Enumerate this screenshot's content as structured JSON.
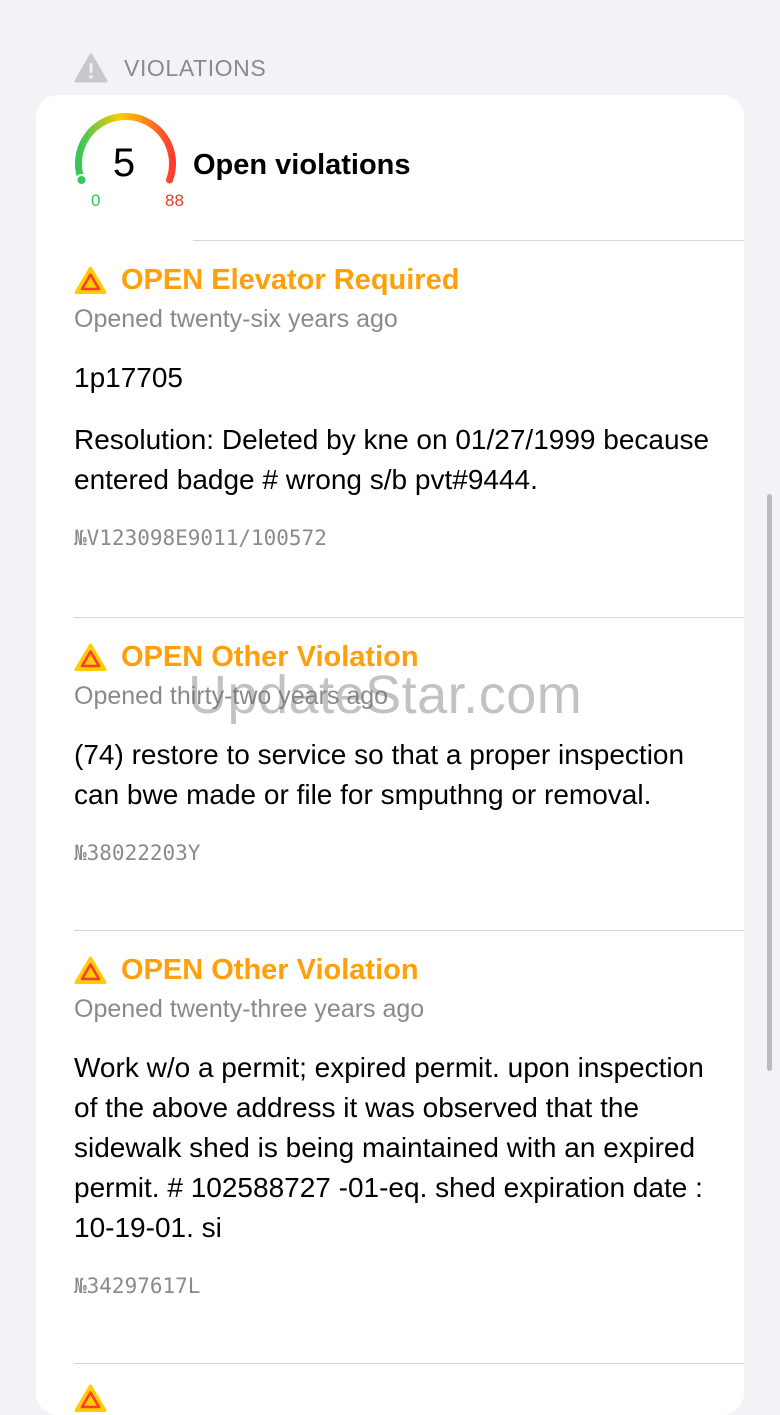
{
  "section": {
    "title": "VIOLATIONS",
    "icon": "warning-triangle-icon"
  },
  "summary": {
    "count": "5",
    "gauge_min": "0",
    "gauge_max": "88",
    "label": "Open violations",
    "colors": {
      "low": "#34c759",
      "mid": "#ffcc00",
      "high": "#ff3b30"
    }
  },
  "violations": {
    "status_color": "#ff9f0a",
    "items": [
      {
        "title": "OPEN Elevator Required",
        "opened": "Opened twenty-six years ago",
        "code": "1p17705",
        "description": "Resolution: Deleted by kne on 01/27/1999 because entered badge # wrong s/b pvt#9444.",
        "number": "№V123098E9011/100572"
      },
      {
        "title": "OPEN Other Violation",
        "opened": "Opened thirty-two years ago",
        "description": "(74) restore to service so that a proper inspection can bwe made or file for smputhng or removal.",
        "number": "№38022203Y"
      },
      {
        "title": "OPEN Other Violation",
        "opened": "Opened twenty-three years ago",
        "description": "Work w/o a permit; expired permit. upon inspection of the above address it was observed that the sidewalk shed is being maintained with an expired permit. # 102588727 -01-eq. shed expiration date : 10-19-01. si",
        "number": "№34297617L"
      }
    ]
  },
  "watermark": "UpdateStar.com"
}
